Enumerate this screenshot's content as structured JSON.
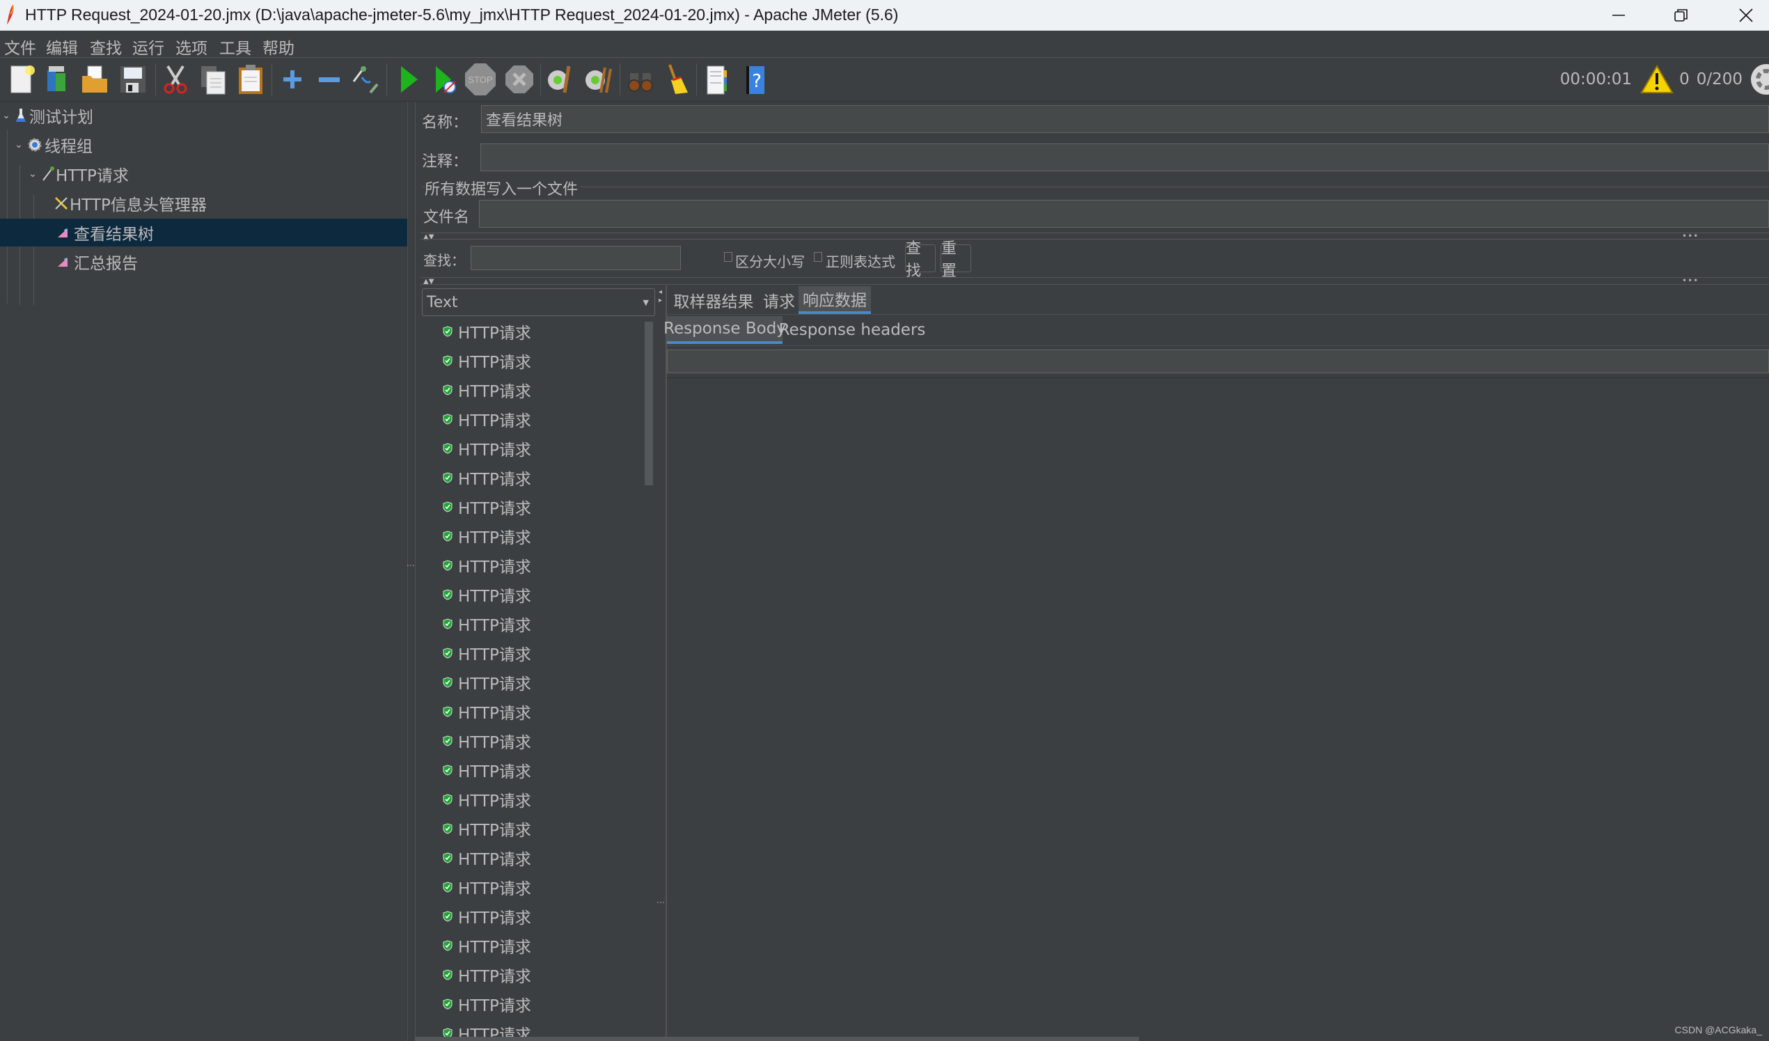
{
  "window": {
    "title": "HTTP Request_2024-01-20.jmx (D:\\java\\apache-jmeter-5.6\\my_jmx\\HTTP Request_2024-01-20.jmx) - Apache JMeter (5.6)",
    "controls": {
      "minimize": "—",
      "restore": "❐",
      "close": "✕"
    }
  },
  "menu": [
    "文件",
    "编辑",
    "查找",
    "运行",
    "选项",
    "工具",
    "帮助"
  ],
  "toolbar": {
    "icons": [
      {
        "name": "new-icon",
        "glyph": "📄"
      },
      {
        "name": "templates-icon",
        "glyph": "📚"
      },
      {
        "name": "open-icon",
        "glyph": "📂"
      },
      {
        "name": "save-icon",
        "glyph": "💾"
      },
      {
        "name": "cut-icon",
        "glyph": "✂"
      },
      {
        "name": "copy-icon",
        "glyph": "📋"
      },
      {
        "name": "paste-icon",
        "glyph": "📋"
      },
      {
        "name": "expand-icon",
        "glyph": "+"
      },
      {
        "name": "collapse-icon",
        "glyph": "−"
      },
      {
        "name": "toggle-icon",
        "glyph": "⤵"
      },
      {
        "name": "start-icon",
        "glyph": "▶"
      },
      {
        "name": "start-no-pauses-icon",
        "glyph": "▶"
      },
      {
        "name": "stop-icon",
        "glyph": "STOP"
      },
      {
        "name": "shutdown-icon",
        "glyph": "✖"
      },
      {
        "name": "clear-icon",
        "glyph": "⚙"
      },
      {
        "name": "clear-all-icon",
        "glyph": "⚙"
      },
      {
        "name": "search-binoculars-icon",
        "glyph": "🔭"
      },
      {
        "name": "reset-search-broom-icon",
        "glyph": "🧹"
      },
      {
        "name": "function-helper-icon",
        "glyph": "📒"
      },
      {
        "name": "help-icon",
        "glyph": "?"
      }
    ]
  },
  "status": {
    "elapsed": "00:00:01",
    "warning_icon": "⚠",
    "errors": "0",
    "threads": "0/200"
  },
  "tree": {
    "items": [
      {
        "label": "测试计划",
        "icon": "test-plan-icon",
        "level": 0,
        "expanded": true
      },
      {
        "label": "线程组",
        "icon": "thread-group-icon",
        "level": 1,
        "expanded": true
      },
      {
        "label": "HTTP请求",
        "icon": "http-sampler-icon",
        "level": 2,
        "expanded": true
      },
      {
        "label": "HTTP信息头管理器",
        "icon": "header-manager-icon",
        "level": 3
      },
      {
        "label": "查看结果树",
        "icon": "listener-icon",
        "level": 3,
        "selected": true
      },
      {
        "label": "汇总报告",
        "icon": "listener-icon",
        "level": 3
      }
    ]
  },
  "form": {
    "name_label": "名称：",
    "name_value": "查看结果树",
    "comment_label": "注释：",
    "comment_value": "",
    "file_group_label": "所有数据写入一个文件",
    "filename_label": "文件名",
    "filename_value": "",
    "search_label": "查找：",
    "search_value": "",
    "case_sensitive_label": "区分大小写",
    "regex_label": "正则表达式",
    "find_button": "查找",
    "reset_button": "重置"
  },
  "results": {
    "renderer": "Text",
    "item_label": "HTTP请求",
    "item_count": 25,
    "tabs": [
      "取样器结果",
      "请求",
      "响应数据"
    ],
    "active_tab": "响应数据",
    "subtabs": [
      "Response Body",
      "Response headers"
    ],
    "active_subtab": "Response Body",
    "body_search_value": ""
  },
  "colors": {
    "background": "#3c3f41",
    "selection": "#0d293e",
    "tab_accent": "#4a88c7",
    "field_bg": "#45494a"
  },
  "watermark": "CSDN @ACGkaka_"
}
